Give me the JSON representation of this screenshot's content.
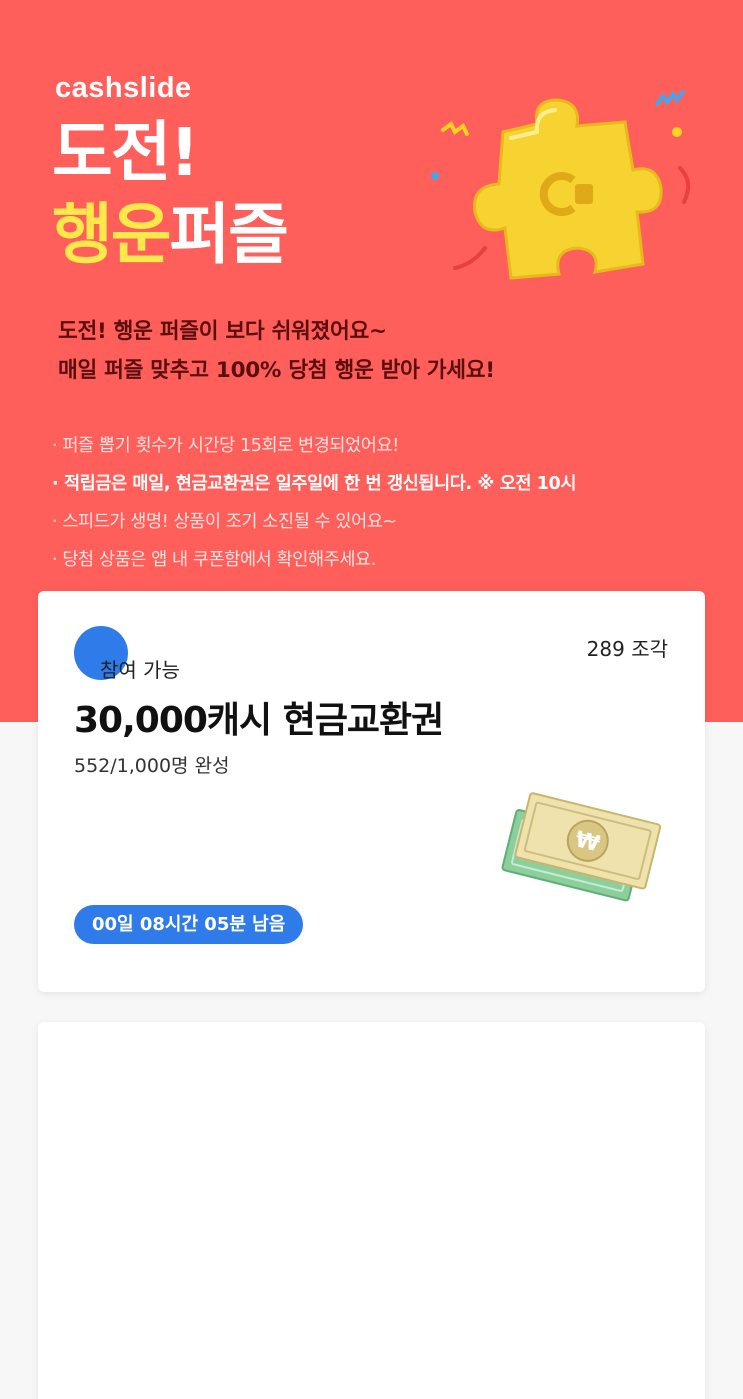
{
  "hero": {
    "brand": "cashslide",
    "title_line1": "도전!",
    "title_line2_highlight": "행운",
    "title_line2_rest": "퍼즐",
    "subtitle_line1": "도전! 행운 퍼즐이 보다 쉬워졌어요~",
    "subtitle_line2": "매일 퍼즐 맞추고 100% 당첨 행운 받아 가세요!",
    "notes": [
      "· 퍼즐 뽑기 횟수가 시간당 15회로 변경되었어요!",
      "· 적립금은 매일, 현금교환권은 일주일에 한 번 갱신됩니다. ※ 오전 10시",
      "· 스피드가 생명! 상품이 조기 소진될 수 있어요~",
      "· 당첨 상품은 앱 내 쿠폰함에서 확인해주세요."
    ]
  },
  "cards": [
    {
      "status": "참여 가능",
      "pieces": "289 조각",
      "prize": "30,000캐시 현금교환권",
      "progress": "552/1,000명 완성",
      "timer": "00일 08시간 05분 남음"
    }
  ],
  "colors": {
    "hero_bg": "#ff5f5a",
    "accent_yellow": "#ffe94a",
    "accent_blue": "#2f7bea",
    "subtitle_dark": "#5a0e0e"
  },
  "icons": {
    "puzzle": "puzzle-piece-icon",
    "money": "banknote-icon"
  }
}
